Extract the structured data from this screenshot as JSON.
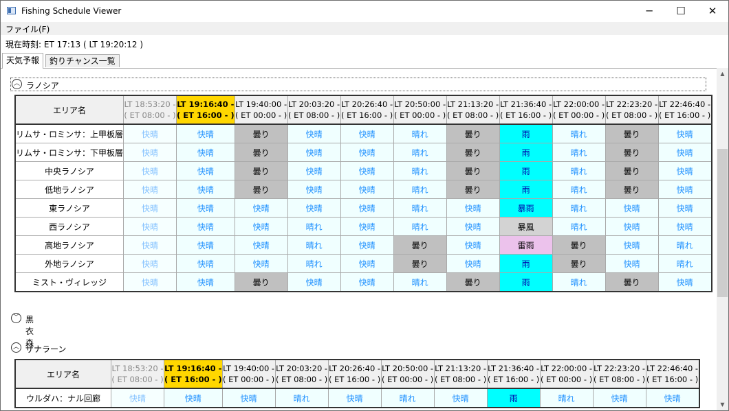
{
  "window": {
    "title": "Fishing Schedule Viewer",
    "minimize": "─",
    "maximize": "☐",
    "close": "✕"
  },
  "menu": {
    "file": "ファイル(F)"
  },
  "clock": {
    "text": "現在時刻:  ET 17:13  ( LT 19:20:12 )"
  },
  "tabs": [
    {
      "label": "天気予報",
      "active": true
    },
    {
      "label": "釣りチャンス一覧",
      "active": false
    }
  ],
  "regions": [
    {
      "name": "ラノシア",
      "expanded": true,
      "focused": true,
      "header_label": "エリア名",
      "times": [
        {
          "lt": "LT 18:53:20 -",
          "et": "( ET 08:00 - )",
          "state": "past"
        },
        {
          "lt": "LT 19:16:40 -",
          "et": "( ET 16:00 - )",
          "state": "current"
        },
        {
          "lt": "LT 19:40:00 -",
          "et": "( ET 00:00 - )",
          "state": "future"
        },
        {
          "lt": "LT 20:03:20 -",
          "et": "( ET 08:00 - )",
          "state": "future"
        },
        {
          "lt": "LT 20:26:40 -",
          "et": "( ET 16:00 - )",
          "state": "future"
        },
        {
          "lt": "LT 20:50:00 -",
          "et": "( ET 00:00 - )",
          "state": "future"
        },
        {
          "lt": "LT 21:13:20 -",
          "et": "( ET 08:00 - )",
          "state": "future"
        },
        {
          "lt": "LT 21:36:40 -",
          "et": "( ET 16:00 - )",
          "state": "future"
        },
        {
          "lt": "LT 22:00:00 -",
          "et": "( ET 00:00 - )",
          "state": "future"
        },
        {
          "lt": "LT 22:23:20 -",
          "et": "( ET 08:00 - )",
          "state": "future"
        },
        {
          "lt": "LT 22:46:40 -",
          "et": "( ET 16:00 - )",
          "state": "future"
        }
      ],
      "areas": [
        {
          "name": "リムサ・ロミンサ：上甲板層",
          "weather": [
            "快晴",
            "快晴",
            "曇り",
            "快晴",
            "快晴",
            "晴れ",
            "曇り",
            "雨",
            "晴れ",
            "曇り",
            "快晴"
          ]
        },
        {
          "name": "リムサ・ロミンサ：下甲板層",
          "weather": [
            "快晴",
            "快晴",
            "曇り",
            "快晴",
            "快晴",
            "晴れ",
            "曇り",
            "雨",
            "晴れ",
            "曇り",
            "快晴"
          ]
        },
        {
          "name": "中央ラノシア",
          "weather": [
            "快晴",
            "快晴",
            "曇り",
            "快晴",
            "快晴",
            "晴れ",
            "曇り",
            "雨",
            "晴れ",
            "曇り",
            "快晴"
          ]
        },
        {
          "name": "低地ラノシア",
          "weather": [
            "快晴",
            "快晴",
            "曇り",
            "快晴",
            "快晴",
            "晴れ",
            "曇り",
            "雨",
            "晴れ",
            "曇り",
            "快晴"
          ]
        },
        {
          "name": "東ラノシア",
          "weather": [
            "快晴",
            "快晴",
            "快晴",
            "快晴",
            "快晴",
            "晴れ",
            "快晴",
            "暴雨",
            "晴れ",
            "快晴",
            "快晴"
          ]
        },
        {
          "name": "西ラノシア",
          "weather": [
            "快晴",
            "快晴",
            "快晴",
            "晴れ",
            "快晴",
            "晴れ",
            "快晴",
            "暴風",
            "晴れ",
            "快晴",
            "快晴"
          ]
        },
        {
          "name": "高地ラノシア",
          "weather": [
            "快晴",
            "快晴",
            "快晴",
            "晴れ",
            "快晴",
            "曇り",
            "快晴",
            "雷雨",
            "曇り",
            "快晴",
            "晴れ"
          ]
        },
        {
          "name": "外地ラノシア",
          "weather": [
            "快晴",
            "快晴",
            "快晴",
            "晴れ",
            "快晴",
            "曇り",
            "快晴",
            "雨",
            "曇り",
            "快晴",
            "晴れ"
          ]
        },
        {
          "name": "ミスト・ヴィレッジ",
          "weather": [
            "快晴",
            "快晴",
            "曇り",
            "快晴",
            "快晴",
            "晴れ",
            "曇り",
            "雨",
            "晴れ",
            "曇り",
            "快晴"
          ]
        }
      ]
    },
    {
      "name": "黒衣森",
      "expanded": false,
      "focused": false
    },
    {
      "name": "ザナラーン",
      "expanded": true,
      "focused": false,
      "header_label": "エリア名",
      "times": [
        {
          "lt": "LT 18:53:20 -",
          "et": "( ET 08:00 - )",
          "state": "past"
        },
        {
          "lt": "LT 19:16:40 -",
          "et": "( ET 16:00 - )",
          "state": "current"
        },
        {
          "lt": "LT 19:40:00 -",
          "et": "( ET 00:00 - )",
          "state": "future"
        },
        {
          "lt": "LT 20:03:20 -",
          "et": "( ET 08:00 - )",
          "state": "future"
        },
        {
          "lt": "LT 20:26:40 -",
          "et": "( ET 16:00 - )",
          "state": "future"
        },
        {
          "lt": "LT 20:50:00 -",
          "et": "( ET 00:00 - )",
          "state": "future"
        },
        {
          "lt": "LT 21:13:20 -",
          "et": "( ET 08:00 - )",
          "state": "future"
        },
        {
          "lt": "LT 21:36:40 -",
          "et": "( ET 16:00 - )",
          "state": "future"
        },
        {
          "lt": "LT 22:00:00 -",
          "et": "( ET 00:00 - )",
          "state": "future"
        },
        {
          "lt": "LT 22:23:20 -",
          "et": "( ET 08:00 - )",
          "state": "future"
        },
        {
          "lt": "LT 22:46:40 -",
          "et": "( ET 16:00 - )",
          "state": "future"
        }
      ],
      "areas": [
        {
          "name": "ウルダハ：ナル回廊",
          "weather": [
            "快晴",
            "快晴",
            "快晴",
            "晴れ",
            "快晴",
            "晴れ",
            "快晴",
            "雨",
            "晴れ",
            "快晴",
            "快晴"
          ]
        }
      ]
    }
  ],
  "icons": {
    "expanded": "chevron-up-icon",
    "collapsed": "chevron-down-icon",
    "scroll_up": "scroll-up-arrow-icon",
    "scroll_down": "scroll-down-arrow-icon"
  }
}
